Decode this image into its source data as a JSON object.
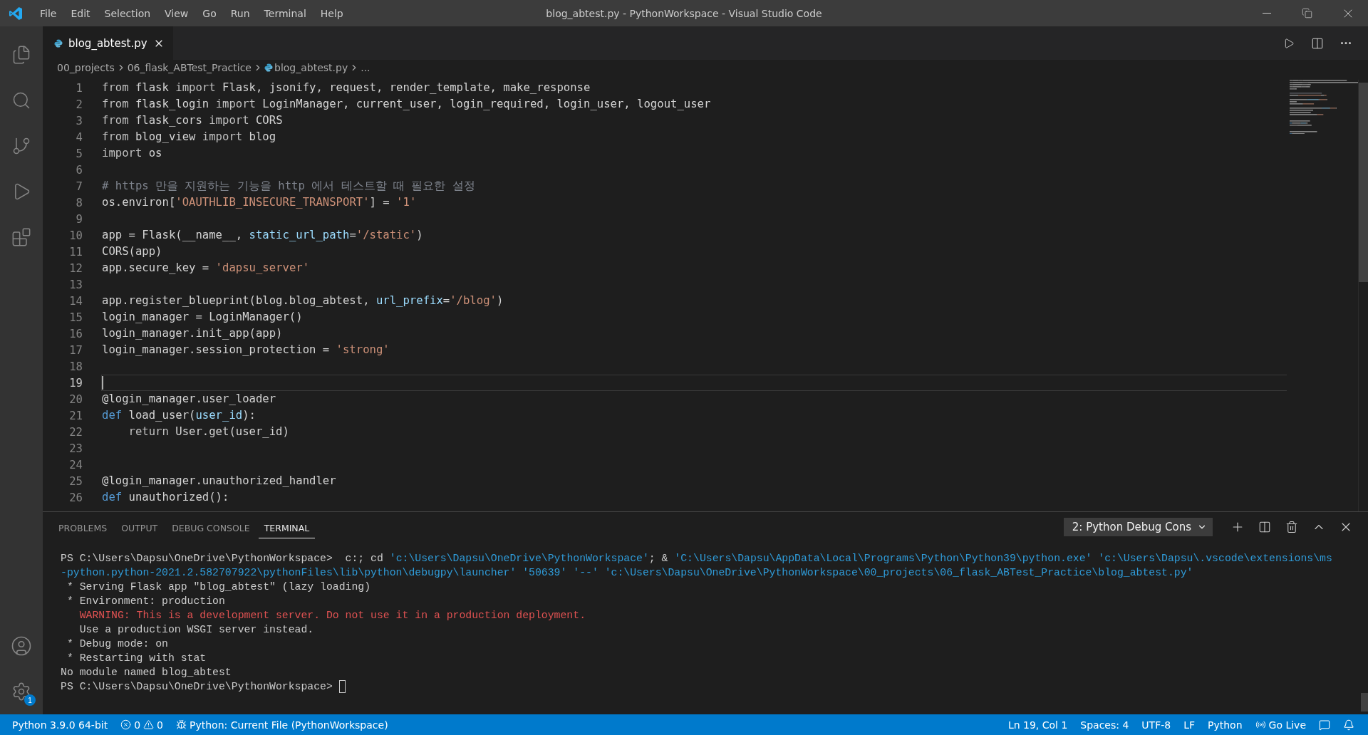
{
  "window": {
    "title": "blog_abtest.py - PythonWorkspace - Visual Studio Code"
  },
  "menu": [
    "File",
    "Edit",
    "Selection",
    "View",
    "Go",
    "Run",
    "Terminal",
    "Help"
  ],
  "activity_bar": {
    "settings_badge": "1"
  },
  "tabs": [
    {
      "label": "blog_abtest.py",
      "selected": true
    }
  ],
  "breadcrumb": [
    "00_projects",
    "06_flask_ABTest_Practice",
    "blog_abtest.py",
    "..."
  ],
  "editor": {
    "lines": [
      {
        "number": "1",
        "current": false,
        "tokens": [
          {
            "text": "from",
            "kind": "kw"
          },
          {
            "text": " flask ",
            "kind": "plain"
          },
          {
            "text": "import",
            "kind": "kw"
          },
          {
            "text": " Flask, jsonify, request, render_template, make_response",
            "kind": "plain"
          }
        ]
      },
      {
        "number": "2",
        "current": false,
        "tokens": [
          {
            "text": "from",
            "kind": "kw"
          },
          {
            "text": " flask_login ",
            "kind": "plain"
          },
          {
            "text": "import",
            "kind": "kw"
          },
          {
            "text": " LoginManager, current_user, login_required, login_user, logout_user",
            "kind": "plain"
          }
        ]
      },
      {
        "number": "3",
        "current": false,
        "tokens": [
          {
            "text": "from",
            "kind": "kw"
          },
          {
            "text": " flask_cors ",
            "kind": "plain"
          },
          {
            "text": "import",
            "kind": "kw"
          },
          {
            "text": " CORS",
            "kind": "plain"
          }
        ]
      },
      {
        "number": "4",
        "current": false,
        "tokens": [
          {
            "text": "from",
            "kind": "kw"
          },
          {
            "text": " blog_view ",
            "kind": "plain"
          },
          {
            "text": "import",
            "kind": "kw"
          },
          {
            "text": " blog",
            "kind": "plain"
          }
        ]
      },
      {
        "number": "5",
        "current": false,
        "tokens": [
          {
            "text": "import",
            "kind": "kw"
          },
          {
            "text": " os",
            "kind": "plain"
          }
        ]
      },
      {
        "number": "6",
        "current": false
      },
      {
        "number": "7",
        "current": false,
        "tokens": [
          {
            "text": "# https 만을 지원하는 기능을 http 에서 테스트할 때 필요한 설정",
            "kind": "comment"
          }
        ]
      },
      {
        "number": "8",
        "current": false,
        "tokens": [
          {
            "text": "os.environ[",
            "kind": "plain"
          },
          {
            "text": "'OAUTHLIB_INSECURE_TRANSPORT'",
            "kind": "str"
          },
          {
            "text": "] = ",
            "kind": "plain"
          },
          {
            "text": "'1'",
            "kind": "str"
          }
        ]
      },
      {
        "number": "9",
        "current": false
      },
      {
        "number": "10",
        "current": false,
        "tokens": [
          {
            "text": "app = Flask(__name__, ",
            "kind": "plain"
          },
          {
            "text": "static_url_path",
            "kind": "param"
          },
          {
            "text": "=",
            "kind": "plain"
          },
          {
            "text": "'/static'",
            "kind": "str"
          },
          {
            "text": ")",
            "kind": "plain"
          }
        ]
      },
      {
        "number": "11",
        "current": false,
        "tokens": [
          {
            "text": "CORS(app)",
            "kind": "plain"
          }
        ]
      },
      {
        "number": "12",
        "current": false,
        "tokens": [
          {
            "text": "app.secure_key = ",
            "kind": "plain"
          },
          {
            "text": "'dapsu_server'",
            "kind": "str"
          }
        ]
      },
      {
        "number": "13",
        "current": false
      },
      {
        "number": "14",
        "current": false,
        "tokens": [
          {
            "text": "app.register_blueprint(blog.blog_abtest, ",
            "kind": "plain"
          },
          {
            "text": "url_prefix",
            "kind": "param"
          },
          {
            "text": "=",
            "kind": "plain"
          },
          {
            "text": "'/blog'",
            "kind": "str"
          },
          {
            "text": ")",
            "kind": "plain"
          }
        ]
      },
      {
        "number": "15",
        "current": false,
        "tokens": [
          {
            "text": "login_manager = LoginManager()",
            "kind": "plain"
          }
        ]
      },
      {
        "number": "16",
        "current": false,
        "tokens": [
          {
            "text": "login_manager.init_app(app)",
            "kind": "plain"
          }
        ]
      },
      {
        "number": "17",
        "current": false,
        "tokens": [
          {
            "text": "login_manager.session_protection = ",
            "kind": "plain"
          },
          {
            "text": "'strong'",
            "kind": "str"
          }
        ]
      },
      {
        "number": "18",
        "current": false
      },
      {
        "number": "19",
        "current": true
      },
      {
        "number": "20",
        "current": false,
        "tokens": [
          {
            "text": "@login_manager.user_loader",
            "kind": "plain"
          }
        ]
      },
      {
        "number": "21",
        "current": false,
        "tokens": [
          {
            "text": "def",
            "kind": "decl"
          },
          {
            "text": " load_user(",
            "kind": "plain"
          },
          {
            "text": "user_id",
            "kind": "param"
          },
          {
            "text": "):",
            "kind": "plain"
          }
        ]
      },
      {
        "number": "22",
        "current": false,
        "tokens": [
          {
            "text": "    return",
            "kind": "kw"
          },
          {
            "text": " User.get(user_id)",
            "kind": "plain"
          }
        ]
      },
      {
        "number": "23",
        "current": false
      },
      {
        "number": "24",
        "current": false
      },
      {
        "number": "25",
        "current": false,
        "tokens": [
          {
            "text": "@login_manager.unauthorized_handler",
            "kind": "plain"
          }
        ]
      },
      {
        "number": "26",
        "current": false,
        "tokens": [
          {
            "text": "def",
            "kind": "decl"
          },
          {
            "text": " unauthorized():",
            "kind": "plain"
          }
        ]
      }
    ]
  },
  "panel": {
    "tabs": [
      {
        "label": "PROBLEMS",
        "selected": false
      },
      {
        "label": "OUTPUT",
        "selected": false
      },
      {
        "label": "DEBUG CONSOLE",
        "selected": false
      },
      {
        "label": "TERMINAL",
        "selected": true
      }
    ],
    "terminal_select": "2: Python Debug Cons",
    "terminal_lines": [
      {
        "cursor": false,
        "segments": [
          {
            "text": "PS C:\\Users\\Dapsu\\OneDrive\\PythonWorkspace>  c:; cd ",
            "kind": "plain"
          },
          {
            "text": "'c:\\Users\\Dapsu\\OneDrive\\PythonWorkspace'",
            "kind": "path"
          },
          {
            "text": "; & ",
            "kind": "plain"
          },
          {
            "text": "'C:\\Users\\Dapsu\\AppData\\Local\\Programs\\Python\\Python39\\python.exe' 'c:\\Users\\Dapsu\\.vscode\\extensions\\ms",
            "kind": "path"
          }
        ]
      },
      {
        "cursor": false,
        "segments": [
          {
            "text": "-python.python-2021.2.582707922\\pythonFiles\\lib\\python\\debugpy\\launcher' '50639' '--' 'c:\\Users\\Dapsu\\OneDrive\\PythonWorkspace\\00_projects\\06_flask_ABTest_Practice\\blog_abtest.py'",
            "kind": "path"
          }
        ]
      },
      {
        "cursor": false,
        "segments": [
          {
            "text": " * Serving Flask app \"blog_abtest\" (lazy loading)",
            "kind": "plain"
          }
        ]
      },
      {
        "cursor": false,
        "segments": [
          {
            "text": " * Environment: production",
            "kind": "plain"
          }
        ]
      },
      {
        "cursor": false,
        "segments": [
          {
            "text": "   WARNING: This is a development server. Do not use it in a production deployment.",
            "kind": "warn"
          }
        ]
      },
      {
        "cursor": false,
        "segments": [
          {
            "text": "   Use a production WSGI server instead.",
            "kind": "plain"
          }
        ]
      },
      {
        "cursor": false,
        "segments": [
          {
            "text": " * Debug mode: on",
            "kind": "plain"
          }
        ]
      },
      {
        "cursor": false,
        "segments": [
          {
            "text": " * Restarting with stat",
            "kind": "plain"
          }
        ]
      },
      {
        "cursor": false,
        "segments": [
          {
            "text": "No module named blog_abtest",
            "kind": "plain"
          }
        ]
      },
      {
        "cursor": true,
        "segments": [
          {
            "text": "PS C:\\Users\\Dapsu\\OneDrive\\PythonWorkspace> ",
            "kind": "plain"
          }
        ]
      }
    ]
  },
  "status_bar": {
    "interpreter": "Python 3.9.0 64-bit",
    "errors": "0",
    "warnings": "0",
    "debug_config": "Python: Current File (PythonWorkspace)",
    "right": [
      "Ln 19, Col 1",
      "Spaces: 4",
      "UTF-8",
      "LF",
      "Python"
    ],
    "go_live": "Go Live"
  }
}
